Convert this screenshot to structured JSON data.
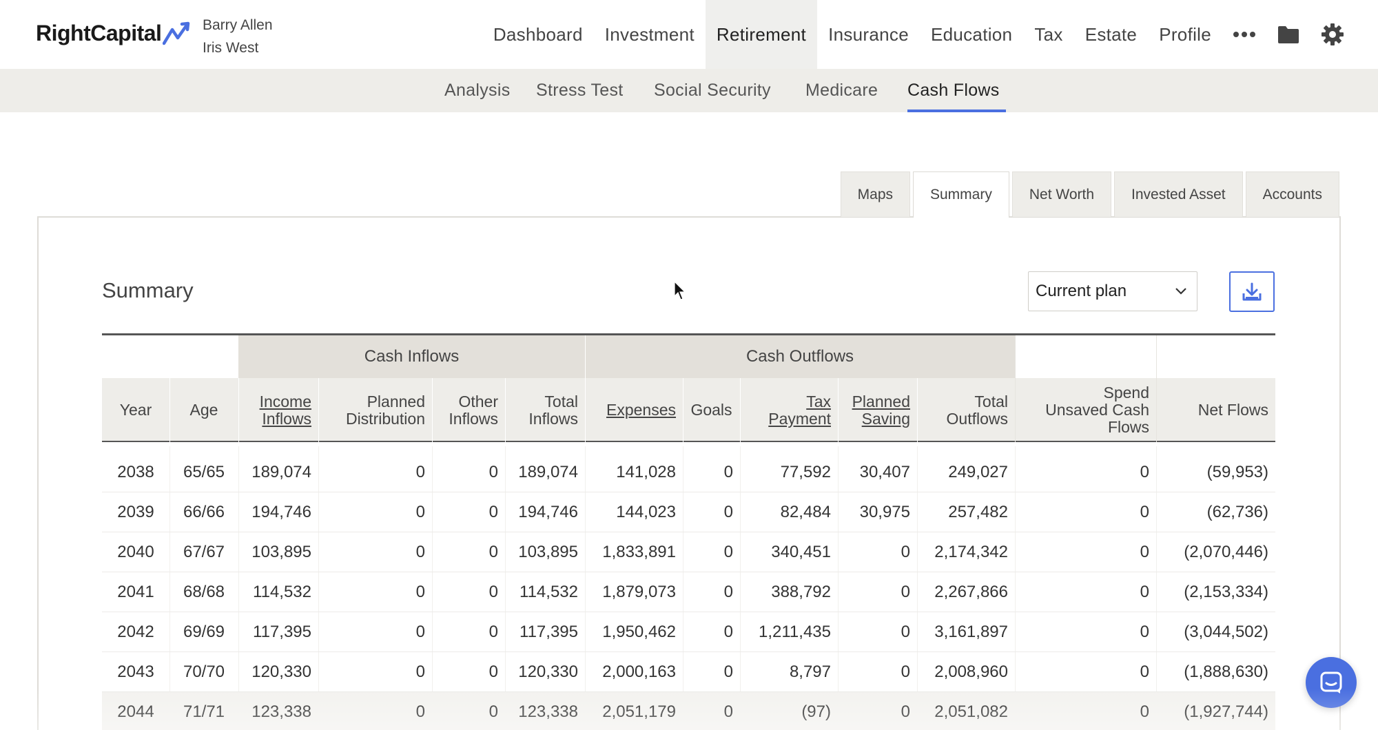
{
  "header": {
    "logo_text": "RightCapital",
    "client_primary": "Barry Allen",
    "client_secondary": "Iris West",
    "nav": [
      "Dashboard",
      "Investment",
      "Retirement",
      "Insurance",
      "Education",
      "Tax",
      "Estate",
      "Profile"
    ],
    "active_nav": "Retirement",
    "icons": [
      "more-icon",
      "folder-icon",
      "gear-icon"
    ]
  },
  "subnav": {
    "items": [
      "Analysis",
      "Stress Test",
      "Social Security",
      "Medicare",
      "Cash Flows"
    ],
    "active": "Cash Flows"
  },
  "tabs": {
    "items": [
      "Maps",
      "Summary",
      "Net Worth",
      "Invested Asset",
      "Accounts"
    ],
    "active": "Summary"
  },
  "summary": {
    "title": "Summary",
    "plan_select_value": "Current plan",
    "group_inflows": "Cash Inflows",
    "group_outflows": "Cash Outflows",
    "columns": [
      "Year",
      "Age",
      "Income Inflows",
      "Planned Distribution",
      "Other Inflows",
      "Total Inflows",
      "Expenses",
      "Goals",
      "Tax Payment",
      "Planned Saving",
      "Total Outflows",
      "Spend Unsaved Cash Flows",
      "Net Flows"
    ],
    "header_lines": {
      "income": [
        "Income",
        "Inflows"
      ],
      "planned_dist": [
        "Planned",
        "Distribution"
      ],
      "other": [
        "Other",
        "Inflows"
      ],
      "total_in": [
        "Total",
        "Inflows"
      ],
      "tax": [
        "Tax",
        "Payment"
      ],
      "saving": [
        "Planned",
        "Saving"
      ],
      "total_out": [
        "Total",
        "Outflows"
      ],
      "spend": [
        "Spend",
        "Unsaved Cash",
        "Flows"
      ]
    },
    "rows": [
      [
        "2038",
        "65/65",
        "189,074",
        "0",
        "0",
        "189,074",
        "141,028",
        "0",
        "77,592",
        "30,407",
        "249,027",
        "0",
        "(59,953)"
      ],
      [
        "2039",
        "66/66",
        "194,746",
        "0",
        "0",
        "194,746",
        "144,023",
        "0",
        "82,484",
        "30,975",
        "257,482",
        "0",
        "(62,736)"
      ],
      [
        "2040",
        "67/67",
        "103,895",
        "0",
        "0",
        "103,895",
        "1,833,891",
        "0",
        "340,451",
        "0",
        "2,174,342",
        "0",
        "(2,070,446)"
      ],
      [
        "2041",
        "68/68",
        "114,532",
        "0",
        "0",
        "114,532",
        "1,879,073",
        "0",
        "388,792",
        "0",
        "2,267,866",
        "0",
        "(2,153,334)"
      ],
      [
        "2042",
        "69/69",
        "117,395",
        "0",
        "0",
        "117,395",
        "1,950,462",
        "0",
        "1,211,435",
        "0",
        "3,161,897",
        "0",
        "(3,044,502)"
      ],
      [
        "2043",
        "70/70",
        "120,330",
        "0",
        "0",
        "120,330",
        "2,000,163",
        "0",
        "8,797",
        "0",
        "2,008,960",
        "0",
        "(1,888,630)"
      ],
      [
        "2044",
        "71/71",
        "123,338",
        "0",
        "0",
        "123,338",
        "2,051,179",
        "0",
        "(97)",
        "0",
        "2,051,082",
        "0",
        "(1,927,744)"
      ]
    ]
  },
  "colors": {
    "accent": "#4a6fe0",
    "header_bg": "#eeede9",
    "group_bg": "#e3e0da"
  }
}
